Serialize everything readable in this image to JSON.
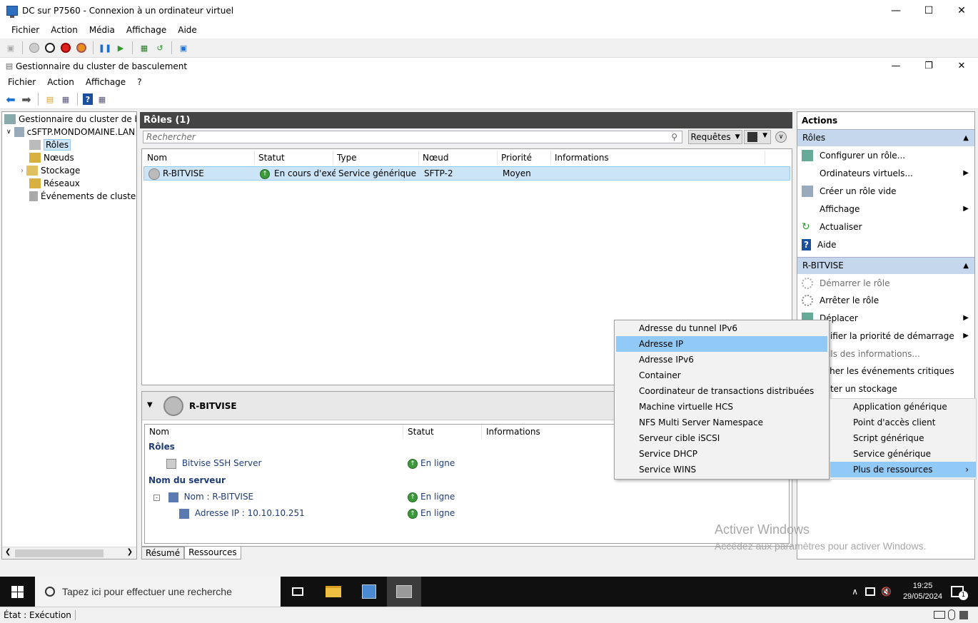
{
  "vm_window": {
    "title": "DC sur P7560 - Connexion à un ordinateur virtuel",
    "menu": [
      "Fichier",
      "Action",
      "Média",
      "Affichage",
      "Aide"
    ]
  },
  "mmc_window": {
    "title": "Gestionnaire du cluster de basculement",
    "menu": [
      "Fichier",
      "Action",
      "Affichage",
      "?"
    ]
  },
  "tree": {
    "root": "Gestionnaire du cluster de basc",
    "cluster": "cSFTP.MONDOMAINE.LAN",
    "items": [
      "Rôles",
      "Nœuds",
      "Stockage",
      "Réseaux",
      "Événements de cluster"
    ]
  },
  "roles_pane": {
    "header": "Rôles (1)",
    "search_placeholder": "Rechercher",
    "queries_label": "Requêtes",
    "columns": [
      "Nom",
      "Statut",
      "Type",
      "Nœud propriétaire",
      "Priorité",
      "Informations"
    ],
    "rows": [
      {
        "name": "R-BITVISE",
        "status": "En cours d'exé...",
        "type": "Service générique",
        "owner": "SFTP-2",
        "priority": "Moyen",
        "info": ""
      }
    ]
  },
  "detail_pane": {
    "title": "R-BITVISE",
    "columns": [
      "Nom",
      "Statut",
      "Informations"
    ],
    "section_roles": "Rôles",
    "role_item": {
      "name": "Bitvise SSH Server",
      "status": "En ligne"
    },
    "section_server": "Nom du serveur",
    "server_item": {
      "name": "Nom : R-BITVISE",
      "status": "En ligne"
    },
    "ip_item": {
      "name": "Adresse IP : 10.10.10.251",
      "status": "En ligne"
    },
    "tabs": [
      "Résumé",
      "Ressources"
    ]
  },
  "actions_pane": {
    "title": "Actions",
    "section1": "Rôles",
    "section1_items": [
      {
        "label": "Configurer un rôle...",
        "arrow": false
      },
      {
        "label": "Ordinateurs virtuels...",
        "arrow": true
      },
      {
        "label": "Créer un rôle vide",
        "arrow": false
      },
      {
        "label": "Affichage",
        "arrow": true
      },
      {
        "label": "Actualiser",
        "arrow": false
      },
      {
        "label": "Aide",
        "arrow": false
      }
    ],
    "section2": "R-BITVISE",
    "section2_items": [
      {
        "label": "Démarrer le rôle",
        "arrow": false,
        "disabled": true
      },
      {
        "label": "Arrêter le rôle",
        "arrow": false,
        "disabled": false
      },
      {
        "label": "Déplacer",
        "arrow": true,
        "disabled": false
      },
      {
        "label": "odifier la priorité de démarrage",
        "arrow": true,
        "disabled": false
      },
      {
        "label": "tails des informations...",
        "arrow": false,
        "disabled": true
      },
      {
        "label": "ficher les événements critiques",
        "arrow": false,
        "disabled": false
      },
      {
        "label": "outer un stockage",
        "arrow": false,
        "disabled": false
      }
    ]
  },
  "context_menu": {
    "items": [
      "Adresse du tunnel IPv6",
      "Adresse IP",
      "Adresse IPv6",
      "Container",
      "Coordinateur de transactions distribuées",
      "Machine virtuelle HCS",
      "NFS Multi Server Namespace",
      "Serveur cible iSCSI",
      "Service DHCP",
      "Service WINS"
    ],
    "highlighted": "Adresse IP"
  },
  "submenu": {
    "items": [
      "Application générique",
      "Point d'accès client",
      "Script générique",
      "Service générique",
      "Plus de ressources"
    ],
    "highlighted": "Plus de ressources"
  },
  "watermark": {
    "line1": "Activer Windows",
    "line2": "Accédez aux paramètres pour activer Windows."
  },
  "taskbar": {
    "search_placeholder": "Tapez ici pour effectuer une recherche",
    "time": "19:25",
    "date": "29/05/2024",
    "notification_count": "1"
  },
  "statusbar": {
    "text": "État : Exécution"
  },
  "colors": {
    "selection": "#cce4f7",
    "menu_highlight": "#91c9f7",
    "section_header": "#c5d7ed",
    "pane_header": "#444444",
    "taskbar": "#101010",
    "status_green": "#3a9a3a"
  }
}
